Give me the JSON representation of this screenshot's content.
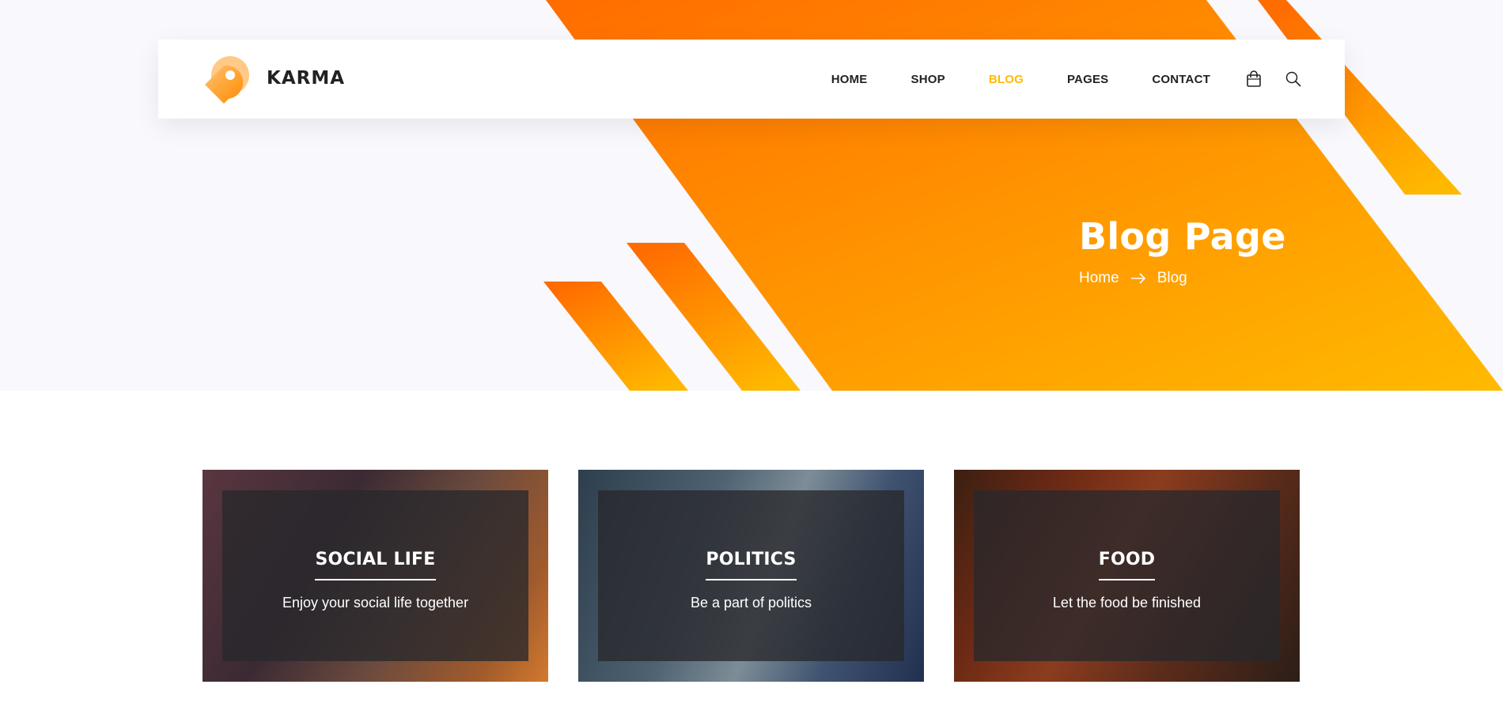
{
  "header": {
    "brand": "KARMA",
    "logo_icon": "location-pin-logo-icon",
    "nav": [
      {
        "label": "HOME",
        "active": false
      },
      {
        "label": "SHOP",
        "active": false
      },
      {
        "label": "BLOG",
        "active": true
      },
      {
        "label": "PAGES",
        "active": false
      },
      {
        "label": "CONTACT",
        "active": false
      }
    ],
    "icons": [
      "shopping-bag-icon",
      "search-icon"
    ]
  },
  "banner": {
    "title": "Blog Page",
    "breadcrumb": [
      "Home",
      "Blog"
    ],
    "separator_icon": "arrow-right-icon"
  },
  "categories": [
    {
      "title": "SOCIAL LIFE",
      "description": "Enjoy your social life together"
    },
    {
      "title": "POLITICS",
      "description": "Be a part of politics"
    },
    {
      "title": "FOOD",
      "description": "Let the food be finished"
    }
  ],
  "colors": {
    "accent": "#ffba00",
    "orange": "#ff6c00",
    "banner_bg": "#f8f8fd",
    "text_dark": "#222222"
  }
}
